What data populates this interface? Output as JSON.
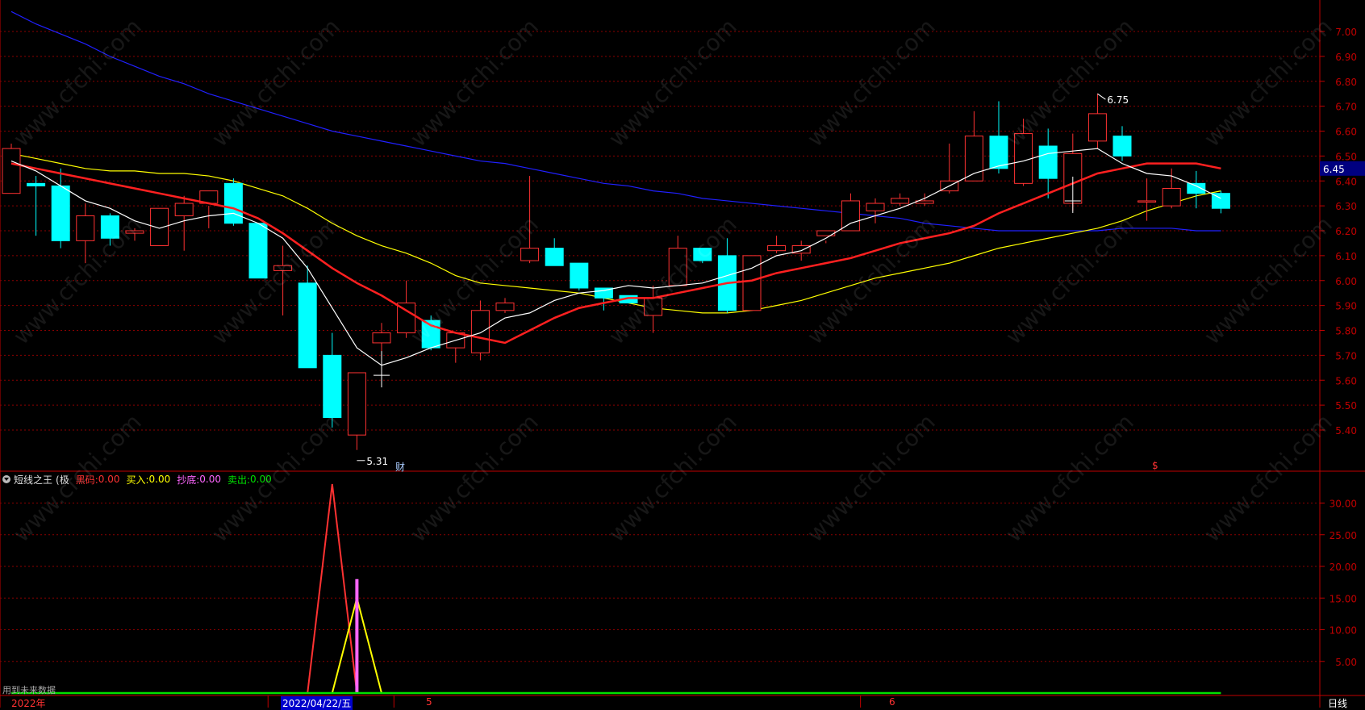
{
  "colors": {
    "up": "#ff3232",
    "down": "#00ffff",
    "grid": "#8b0000",
    "axis": "#c00000",
    "ma5": "#ffffff",
    "ma10": "#ff2020",
    "ma20": "#ffff00",
    "ma60": "#2020ff",
    "green": "#00e000",
    "pink": "#ff66ff"
  },
  "watermark": "www.cfchi.com",
  "main_axis": {
    "ticks": [
      "7.00",
      "6.90",
      "6.80",
      "6.70",
      "6.60",
      "6.50",
      "6.40",
      "6.30",
      "6.20",
      "6.10",
      "6.00",
      "5.90",
      "5.80",
      "5.70",
      "5.60",
      "5.50",
      "5.40"
    ],
    "current_price": "6.45"
  },
  "sub_axis": {
    "ticks": [
      "30.00",
      "25.00",
      "20.00",
      "15.00",
      "10.00",
      "5.00"
    ]
  },
  "annotations": {
    "high": "6.75",
    "low": "5.31",
    "cai": "财",
    "s_marker": "$"
  },
  "indicator": {
    "name": "短线之王",
    "name_suffix": "(极",
    "items": [
      {
        "label": "黑码:",
        "value": "0.00",
        "color": "#ff3232"
      },
      {
        "label": "买入:",
        "value": "0.00",
        "color": "#ffff00"
      },
      {
        "label": "抄底:",
        "value": "0.00",
        "color": "#ff66ff"
      },
      {
        "label": "卖出:",
        "value": "0.00",
        "color": "#00e000"
      }
    ]
  },
  "footer": {
    "year_label": "2022年",
    "date_label": "2022/04/22/五",
    "month_5": "5",
    "month_6": "6",
    "period": "日线",
    "overlay_text": "用到未来数据"
  },
  "chart_data": [
    {
      "type": "candlestick",
      "ylim": [
        5.27,
        7.1
      ],
      "ohlc": [
        [
          6.35,
          6.55,
          6.35,
          6.53
        ],
        [
          6.39,
          6.42,
          6.18,
          6.38
        ],
        [
          6.38,
          6.45,
          6.13,
          6.16
        ],
        [
          6.16,
          6.31,
          6.07,
          6.26
        ],
        [
          6.26,
          6.27,
          6.14,
          6.17
        ],
        [
          6.19,
          6.21,
          6.16,
          6.2
        ],
        [
          6.14,
          6.28,
          6.14,
          6.29
        ],
        [
          6.26,
          6.34,
          6.12,
          6.31
        ],
        [
          6.31,
          6.3,
          6.21,
          6.36
        ],
        [
          6.39,
          6.41,
          6.22,
          6.23
        ],
        [
          6.23,
          6.23,
          6.01,
          6.01
        ],
        [
          6.04,
          6.14,
          5.86,
          6.06
        ],
        [
          5.99,
          6.06,
          5.65,
          5.65
        ],
        [
          5.7,
          5.79,
          5.41,
          5.45
        ],
        [
          5.38,
          5.63,
          5.32,
          5.63
        ],
        [
          5.75,
          5.83,
          5.64,
          5.79
        ],
        [
          5.79,
          6.0,
          5.77,
          5.91
        ],
        [
          5.84,
          5.86,
          5.72,
          5.73
        ],
        [
          5.73,
          5.79,
          5.67,
          5.79
        ],
        [
          5.71,
          5.92,
          5.68,
          5.88
        ],
        [
          5.88,
          5.93,
          5.87,
          5.91
        ],
        [
          6.08,
          6.42,
          6.07,
          6.13
        ],
        [
          6.13,
          6.17,
          6.06,
          6.06
        ],
        [
          6.07,
          6.07,
          5.96,
          5.97
        ],
        [
          5.97,
          5.97,
          5.88,
          5.93
        ],
        [
          5.94,
          5.94,
          5.93,
          5.91
        ],
        [
          5.86,
          5.98,
          5.79,
          5.93
        ],
        [
          5.98,
          6.18,
          5.98,
          6.13
        ],
        [
          6.13,
          6.08,
          6.07,
          6.08
        ],
        [
          6.1,
          6.17,
          5.87,
          5.88
        ],
        [
          5.88,
          6.1,
          5.88,
          6.1
        ],
        [
          6.12,
          6.18,
          6.11,
          6.14
        ],
        [
          6.11,
          6.16,
          6.08,
          6.14
        ],
        [
          6.18,
          6.16,
          6.15,
          6.2
        ],
        [
          6.2,
          6.35,
          6.21,
          6.32
        ],
        [
          6.28,
          6.33,
          6.23,
          6.31
        ],
        [
          6.31,
          6.35,
          6.3,
          6.33
        ],
        [
          6.31,
          6.35,
          6.3,
          6.32
        ],
        [
          6.36,
          6.55,
          6.35,
          6.4
        ],
        [
          6.4,
          6.68,
          6.4,
          6.58
        ],
        [
          6.58,
          6.72,
          6.43,
          6.45
        ],
        [
          6.39,
          6.65,
          6.38,
          6.59
        ],
        [
          6.54,
          6.61,
          6.33,
          6.41
        ],
        [
          6.31,
          6.59,
          6.28,
          6.51
        ],
        [
          6.56,
          6.75,
          6.53,
          6.67
        ],
        [
          6.58,
          6.62,
          6.48,
          6.5
        ],
        [
          6.32,
          6.41,
          6.24,
          6.32
        ],
        [
          6.3,
          6.45,
          6.29,
          6.37
        ],
        [
          6.39,
          6.44,
          6.29,
          6.35
        ],
        [
          6.35,
          6.36,
          6.27,
          6.29
        ]
      ],
      "ma5": [
        6.48,
        6.44,
        6.38,
        6.32,
        6.29,
        6.24,
        6.21,
        6.24,
        6.26,
        6.27,
        6.23,
        6.17,
        6.05,
        5.89,
        5.73,
        5.66,
        5.69,
        5.73,
        5.76,
        5.79,
        5.85,
        5.87,
        5.92,
        5.95,
        5.96,
        5.98,
        5.97,
        5.98,
        5.99,
        6.02,
        6.05,
        6.1,
        6.12,
        6.17,
        6.23,
        6.26,
        6.29,
        6.33,
        6.38,
        6.43,
        6.46,
        6.48,
        6.51,
        6.52,
        6.53,
        6.47,
        6.43,
        6.42,
        6.38,
        6.33
      ],
      "ma10": [
        6.47,
        6.45,
        6.43,
        6.41,
        6.39,
        6.37,
        6.35,
        6.33,
        6.31,
        6.29,
        6.25,
        6.19,
        6.12,
        6.05,
        5.99,
        5.94,
        5.88,
        5.82,
        5.79,
        5.77,
        5.75,
        5.8,
        5.85,
        5.89,
        5.91,
        5.93,
        5.93,
        5.95,
        5.97,
        5.99,
        6.0,
        6.03,
        6.05,
        6.07,
        6.09,
        6.12,
        6.15,
        6.17,
        6.19,
        6.22,
        6.27,
        6.31,
        6.35,
        6.39,
        6.43,
        6.45,
        6.47,
        6.47,
        6.47,
        6.45
      ],
      "ma20": [
        6.51,
        6.49,
        6.47,
        6.45,
        6.44,
        6.44,
        6.43,
        6.43,
        6.42,
        6.4,
        6.37,
        6.34,
        6.29,
        6.23,
        6.18,
        6.14,
        6.11,
        6.07,
        6.02,
        5.99,
        5.98,
        5.97,
        5.96,
        5.95,
        5.93,
        5.91,
        5.89,
        5.88,
        5.87,
        5.87,
        5.88,
        5.9,
        5.92,
        5.95,
        5.98,
        6.01,
        6.03,
        6.05,
        6.07,
        6.1,
        6.13,
        6.15,
        6.17,
        6.19,
        6.21,
        6.24,
        6.28,
        6.31,
        6.34,
        6.36
      ],
      "ma60": [
        7.08,
        7.03,
        6.99,
        6.95,
        6.9,
        6.86,
        6.82,
        6.79,
        6.75,
        6.72,
        6.69,
        6.66,
        6.63,
        6.6,
        6.58,
        6.56,
        6.54,
        6.52,
        6.5,
        6.48,
        6.47,
        6.45,
        6.43,
        6.41,
        6.39,
        6.38,
        6.36,
        6.35,
        6.33,
        6.32,
        6.31,
        6.3,
        6.29,
        6.28,
        6.27,
        6.26,
        6.25,
        6.23,
        6.22,
        6.21,
        6.2,
        6.2,
        6.2,
        6.2,
        6.2,
        6.21,
        6.21,
        6.21,
        6.2,
        6.2
      ]
    },
    {
      "type": "line",
      "ylim": [
        0,
        35
      ],
      "series": [
        {
          "values": [
            [
              12,
              0
            ],
            [
              13,
              33
            ],
            [
              14,
              0
            ]
          ]
        },
        {
          "values": [
            [
              13,
              0
            ],
            [
              14,
              15
            ],
            [
              15,
              0
            ]
          ]
        },
        {
          "values": [
            [
              14,
              0
            ],
            [
              14,
              18
            ],
            [
              14,
              0
            ]
          ]
        },
        {
          "values": [
            [
              0,
              0
            ],
            [
              49,
              0
            ]
          ]
        }
      ]
    }
  ]
}
